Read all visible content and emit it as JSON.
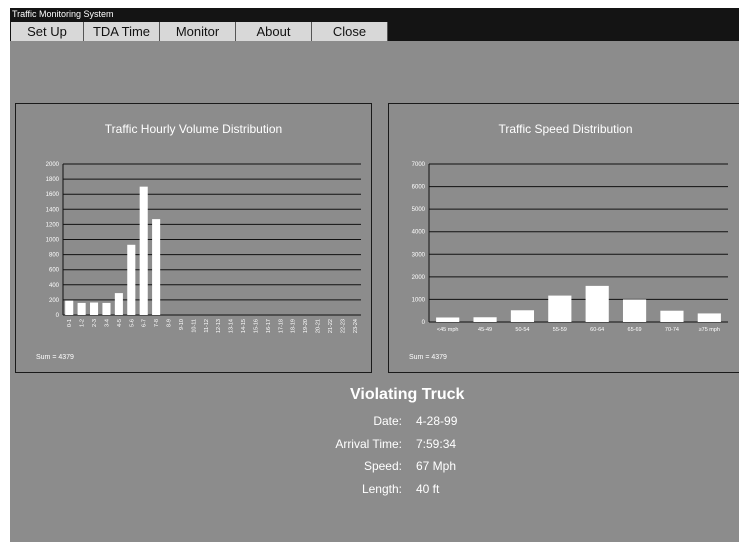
{
  "window": {
    "title": "Traffic Monitoring System"
  },
  "menu": [
    {
      "label": "Set Up"
    },
    {
      "label": "TDA Time"
    },
    {
      "label": "Monitor"
    },
    {
      "label": "About"
    },
    {
      "label": "Close"
    }
  ],
  "volume_panel": {
    "title": "Traffic Hourly Volume Distribution",
    "sum": "Sum = 4379"
  },
  "speed_panel": {
    "title": "Traffic Speed Distribution",
    "sum": "Sum = 4379"
  },
  "truck": {
    "title": "Violating Truck",
    "fields": [
      {
        "label": "Date:",
        "value": "4-28-99"
      },
      {
        "label": "Arrival Time:",
        "value": "7:59:34"
      },
      {
        "label": "Speed:",
        "value": "67 Mph"
      },
      {
        "label": "Length:",
        "value": "40 ft"
      }
    ]
  },
  "colors": {
    "window_bg": "#8c8c8c",
    "bars": "#ffffff",
    "titlebar": "#141414",
    "menu_button": "#d8d8d8"
  },
  "chart_data": [
    {
      "type": "bar",
      "title": "Traffic Hourly Volume Distribution",
      "categories": [
        "0-1",
        "1-2",
        "2-3",
        "3-4",
        "4-5",
        "5-6",
        "6-7",
        "7-8",
        "8-9",
        "9-10",
        "10-11",
        "11-12",
        "12-13",
        "13-14",
        "14-15",
        "15-16",
        "16-17",
        "17-18",
        "18-19",
        "19-20",
        "20-21",
        "21-22",
        "22-23",
        "23-24"
      ],
      "values": [
        190,
        160,
        165,
        160,
        290,
        930,
        1700,
        1270,
        0,
        0,
        0,
        0,
        0,
        0,
        0,
        0,
        0,
        0,
        0,
        0,
        0,
        0,
        0,
        0
      ],
      "yticks": [
        0,
        200,
        400,
        600,
        800,
        1000,
        1200,
        1400,
        1600,
        1800,
        2000
      ],
      "ylim": [
        0,
        2000
      ],
      "grid": true,
      "note": "Sum = 4379"
    },
    {
      "type": "bar",
      "title": "Traffic Speed Distribution",
      "categories": [
        "<45 mph",
        "45-49",
        "50-54",
        "55-59",
        "60-64",
        "65-69",
        "70-74",
        "≥75 mph"
      ],
      "values": [
        200,
        210,
        520,
        1170,
        1600,
        1000,
        500,
        380
      ],
      "yticks": [
        0,
        1000,
        2000,
        3000,
        4000,
        5000,
        6000,
        7000
      ],
      "ylim": [
        0,
        7000
      ],
      "grid": true,
      "note": "Sum = 4379"
    }
  ]
}
